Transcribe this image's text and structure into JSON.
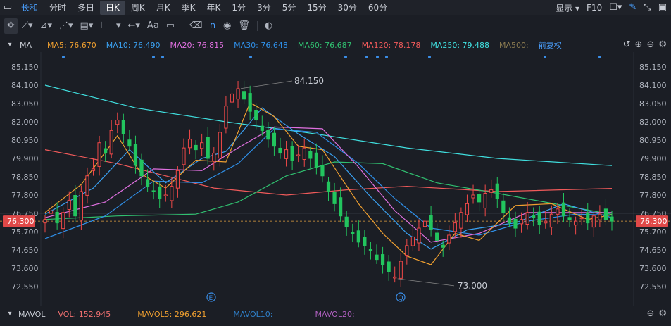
{
  "tabs": {
    "items": [
      {
        "label": "长和",
        "state": "active"
      },
      {
        "label": "分时",
        "state": ""
      },
      {
        "label": "多日",
        "state": ""
      },
      {
        "label": "日K",
        "state": "sel"
      },
      {
        "label": "周K",
        "state": ""
      },
      {
        "label": "月K",
        "state": ""
      },
      {
        "label": "季K",
        "state": ""
      },
      {
        "label": "年K",
        "state": ""
      },
      {
        "label": "1分",
        "state": ""
      },
      {
        "label": "3分",
        "state": ""
      },
      {
        "label": "5分",
        "state": ""
      },
      {
        "label": "15分",
        "state": ""
      },
      {
        "label": "30分",
        "state": ""
      },
      {
        "label": "60分",
        "state": ""
      }
    ],
    "display_label": "显示",
    "f10_label": "F10"
  },
  "ma": {
    "label": "MA",
    "items": [
      {
        "text": "MA5: 76.670",
        "color": "#f0a030"
      },
      {
        "text": "MA10: 76.490",
        "color": "#3aa0f0"
      },
      {
        "text": "MA20: 76.815",
        "color": "#e070e0"
      },
      {
        "text": "MA30: 76.648",
        "color": "#2f8fe8"
      },
      {
        "text": "MA60: 76.687",
        "color": "#30c070"
      },
      {
        "text": "MA120: 78.178",
        "color": "#f05a5a"
      },
      {
        "text": "MA250: 79.488",
        "color": "#40e0e0"
      },
      {
        "text": "MA500: ",
        "color": "#8a7a50"
      }
    ],
    "adjust_label": "前复权"
  },
  "axis": {
    "ticks": [
      "85.150",
      "84.100",
      "83.050",
      "82.000",
      "80.950",
      "79.900",
      "78.850",
      "77.800",
      "76.750",
      "75.700",
      "74.650",
      "73.600",
      "72.550"
    ],
    "current": "76.300",
    "high": "84.150",
    "low": "73.000"
  },
  "volume": {
    "label": "MAVOL",
    "vol": "VOL: 152.945",
    "mavol5": "MAVOL5: 296.621",
    "mavol10": "MAVOL10:",
    "mavol20": "MAVOL20:"
  },
  "colors": {
    "up": "#f04848",
    "down": "#22c55e",
    "bg": "#1b1e25",
    "accent": "#4aa0ff"
  }
}
